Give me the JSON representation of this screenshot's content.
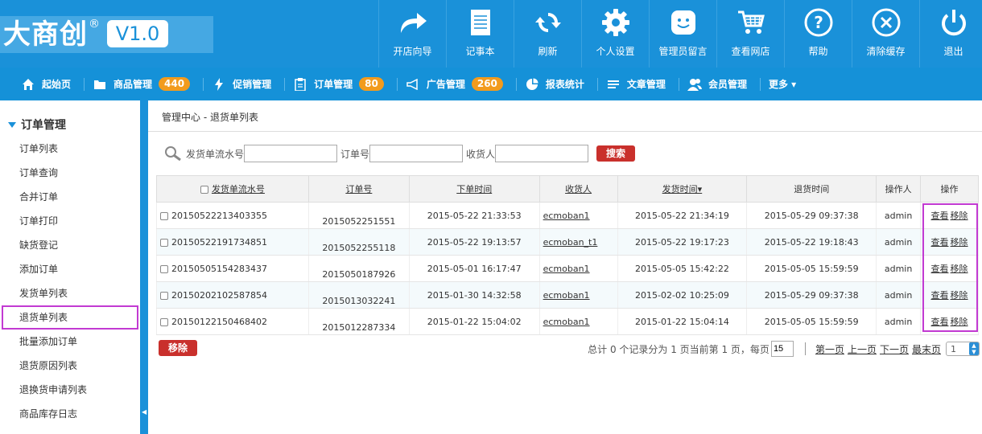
{
  "brand": {
    "name": "大商创",
    "reg": "®",
    "version": "V1.0"
  },
  "topnav": [
    {
      "label": "开店向导",
      "icon": "share-arrow-icon"
    },
    {
      "label": "记事本",
      "icon": "notepad-icon"
    },
    {
      "label": "刷新",
      "icon": "refresh-icon"
    },
    {
      "label": "个人设置",
      "icon": "gear-icon"
    },
    {
      "label": "管理员留言",
      "icon": "message-smile-icon"
    },
    {
      "label": "查看网店",
      "icon": "cart-icon"
    },
    {
      "label": "帮助",
      "icon": "help-icon"
    },
    {
      "label": "清除缓存",
      "icon": "clear-cache-icon"
    },
    {
      "label": "退出",
      "icon": "power-icon"
    }
  ],
  "navbar": [
    {
      "label": "起始页",
      "icon": "home-icon"
    },
    {
      "label": "商品管理",
      "icon": "folder-icon",
      "badge": "440"
    },
    {
      "label": "促销管理",
      "icon": "lightning-icon"
    },
    {
      "label": "订单管理",
      "icon": "clipboard-icon",
      "badge": "80"
    },
    {
      "label": "广告管理",
      "icon": "megaphone-icon",
      "badge": "260"
    },
    {
      "label": "报表统计",
      "icon": "pie-chart-icon"
    },
    {
      "label": "文章管理",
      "icon": "list-icon"
    },
    {
      "label": "会员管理",
      "icon": "users-icon"
    },
    {
      "label": "更多 ▾",
      "icon": ""
    }
  ],
  "sidebar": {
    "title": "订单管理",
    "items": [
      "订单列表",
      "订单查询",
      "合并订单",
      "订单打印",
      "缺货登记",
      "添加订单",
      "发货单列表",
      "退货单列表",
      "批量添加订单",
      "退货原因列表",
      "退换货申请列表",
      "商品库存日志"
    ],
    "active_index": 7
  },
  "breadcrumb": {
    "root": "管理中心",
    "sep": " - ",
    "current": "退货单列表"
  },
  "search": {
    "label_delivery_sn": "发货单流水号",
    "label_order_sn": "订单号",
    "label_consignee": "收货人",
    "value_delivery_sn": "",
    "value_order_sn": "",
    "value_consignee": "",
    "button": "搜索"
  },
  "table": {
    "headers": [
      "发货单流水号",
      "订单号",
      "下单时间",
      "收货人",
      "发货时间▾",
      "退货时间",
      "操作人",
      "操作"
    ],
    "view_label": "查看",
    "remove_label": "移除",
    "rows": [
      {
        "delivery_sn": "20150522213403355",
        "order_sn": "2015052251551",
        "order_time": "2015-05-22 21:33:53",
        "consignee": "ecmoban1",
        "ship_time": "2015-05-22 21:34:19",
        "return_time": "2015-05-29 09:37:38",
        "operator": "admin"
      },
      {
        "delivery_sn": "20150522191734851",
        "order_sn": "2015052255118",
        "order_time": "2015-05-22 19:13:57",
        "consignee": "ecmoban_t1",
        "ship_time": "2015-05-22 19:17:23",
        "return_time": "2015-05-22 19:18:43",
        "operator": "admin"
      },
      {
        "delivery_sn": "20150505154283437",
        "order_sn": "2015050187926",
        "order_time": "2015-05-01 16:17:47",
        "consignee": "ecmoban1",
        "ship_time": "2015-05-05 15:42:22",
        "return_time": "2015-05-05 15:59:59",
        "operator": "admin"
      },
      {
        "delivery_sn": "20150202102587854",
        "order_sn": "2015013032241",
        "order_time": "2015-01-30 14:32:58",
        "consignee": "ecmoban1",
        "ship_time": "2015-02-02 10:25:09",
        "return_time": "2015-05-29 09:37:38",
        "operator": "admin"
      },
      {
        "delivery_sn": "20150122150468402",
        "order_sn": "2015012287334",
        "order_time": "2015-01-22 15:04:02",
        "consignee": "ecmoban1",
        "ship_time": "2015-01-22 15:04:14",
        "return_time": "2015-05-05 15:59:59",
        "operator": "admin"
      }
    ]
  },
  "footer": {
    "remove_button": "移除",
    "summary": "总计 0 个记录分为 1 页当前第 1 页，每页",
    "page_size": "15",
    "first": "第一页",
    "prev": "上一页",
    "next": "下一页",
    "last": "最末页",
    "page_select": "1"
  },
  "colors": {
    "primary": "#1a91d9",
    "badge": "#f29b1d",
    "danger": "#c9302c",
    "highlight": "#c23ad2"
  }
}
